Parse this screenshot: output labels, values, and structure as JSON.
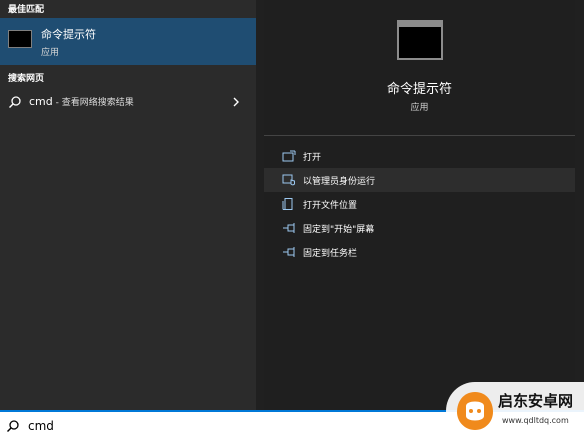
{
  "best_match": {
    "header": "最佳匹配",
    "title": "命令提示符",
    "subtitle": "应用",
    "icon": "command-prompt-icon"
  },
  "web_search": {
    "header": "搜索网页",
    "query": "cmd",
    "suffix": " - 查看网络搜索结果",
    "icon": "search-icon"
  },
  "preview": {
    "title": "命令提示符",
    "subtitle": "应用",
    "icon": "command-prompt-icon"
  },
  "actions": [
    {
      "label": "打开",
      "icon": "open-window-icon"
    },
    {
      "label": "以管理员身份运行",
      "icon": "run-as-admin-icon"
    },
    {
      "label": "打开文件位置",
      "icon": "file-location-icon"
    },
    {
      "label": "固定到\"开始\"屏幕",
      "icon": "pin-icon"
    },
    {
      "label": "固定到任务栏",
      "icon": "pin-icon"
    }
  ],
  "search_box": {
    "value": "cmd",
    "icon": "search-icon"
  },
  "watermark": {
    "name": "启东安卓网",
    "url": "www.qdltdq.com"
  },
  "colors": {
    "selected": "#1f4d72",
    "pane_left": "#2b2b2b",
    "pane_right": "#1f1f1f",
    "accent": "#0078d7",
    "logo_orange": "#f08a1c"
  }
}
